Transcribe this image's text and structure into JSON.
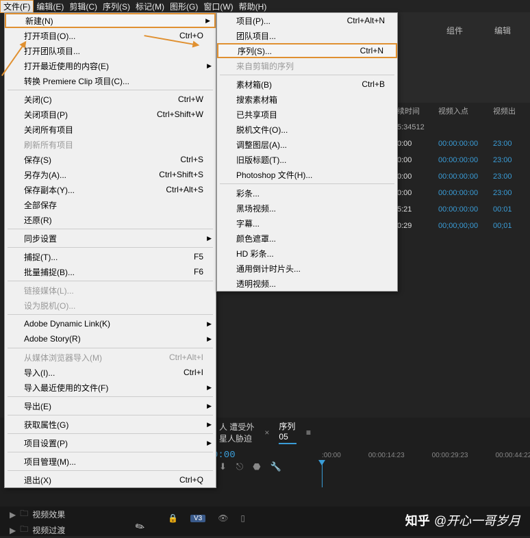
{
  "menubar": [
    {
      "label": "文件(F)",
      "active": true
    },
    {
      "label": "编辑(E)"
    },
    {
      "label": "剪辑(C)"
    },
    {
      "label": "序列(S)"
    },
    {
      "label": "标记(M)"
    },
    {
      "label": "图形(G)"
    },
    {
      "label": "窗口(W)"
    },
    {
      "label": "帮助(H)"
    }
  ],
  "file_menu": [
    {
      "label": "新建(N)",
      "arrow": true,
      "highlight": true
    },
    {
      "label": "打开项目(O)...",
      "shortcut": "Ctrl+O"
    },
    {
      "label": "打开团队项目..."
    },
    {
      "label": "打开最近使用的内容(E)",
      "arrow": true
    },
    {
      "label": "转换 Premiere Clip 项目(C)..."
    },
    {
      "sep": true
    },
    {
      "label": "关闭(C)",
      "shortcut": "Ctrl+W"
    },
    {
      "label": "关闭项目(P)",
      "shortcut": "Ctrl+Shift+W"
    },
    {
      "label": "关闭所有项目"
    },
    {
      "label": "刷新所有项目",
      "disabled": true
    },
    {
      "label": "保存(S)",
      "shortcut": "Ctrl+S"
    },
    {
      "label": "另存为(A)...",
      "shortcut": "Ctrl+Shift+S"
    },
    {
      "label": "保存副本(Y)...",
      "shortcut": "Ctrl+Alt+S"
    },
    {
      "label": "全部保存"
    },
    {
      "label": "还原(R)"
    },
    {
      "sep": true
    },
    {
      "label": "同步设置",
      "arrow": true
    },
    {
      "sep": true
    },
    {
      "label": "捕捉(T)...",
      "shortcut": "F5"
    },
    {
      "label": "批量捕捉(B)...",
      "shortcut": "F6"
    },
    {
      "sep": true
    },
    {
      "label": "链接媒体(L)...",
      "disabled": true
    },
    {
      "label": "设为脱机(O)...",
      "disabled": true
    },
    {
      "sep": true
    },
    {
      "label": "Adobe Dynamic Link(K)",
      "arrow": true
    },
    {
      "label": "Adobe Story(R)",
      "arrow": true
    },
    {
      "sep": true
    },
    {
      "label": "从媒体浏览器导入(M)",
      "shortcut": "Ctrl+Alt+I",
      "disabled": true
    },
    {
      "label": "导入(I)...",
      "shortcut": "Ctrl+I"
    },
    {
      "label": "导入最近使用的文件(F)",
      "arrow": true
    },
    {
      "sep": true
    },
    {
      "label": "导出(E)",
      "arrow": true
    },
    {
      "sep": true
    },
    {
      "label": "获取属性(G)",
      "arrow": true
    },
    {
      "sep": true
    },
    {
      "label": "项目设置(P)",
      "arrow": true
    },
    {
      "sep": true
    },
    {
      "label": "项目管理(M)..."
    },
    {
      "sep": true
    },
    {
      "label": "退出(X)",
      "shortcut": "Ctrl+Q"
    }
  ],
  "new_submenu": [
    {
      "label": "项目(P)...",
      "shortcut": "Ctrl+Alt+N"
    },
    {
      "label": "团队项目..."
    },
    {
      "label": "序列(S)...",
      "shortcut": "Ctrl+N",
      "highlight": true
    },
    {
      "label": "来自剪辑的序列",
      "disabled": true
    },
    {
      "sep": true
    },
    {
      "label": "素材箱(B)",
      "shortcut": "Ctrl+B"
    },
    {
      "label": "搜索素材箱"
    },
    {
      "label": "已共享项目"
    },
    {
      "label": "脱机文件(O)..."
    },
    {
      "label": "调整图层(A)..."
    },
    {
      "label": "旧版标题(T)..."
    },
    {
      "label": "Photoshop 文件(H)..."
    },
    {
      "sep": true
    },
    {
      "label": "彩条..."
    },
    {
      "label": "黑场视频..."
    },
    {
      "label": "字幕..."
    },
    {
      "label": "颜色遮罩..."
    },
    {
      "label": "HD 彩条..."
    },
    {
      "label": "通用倒计时片头..."
    },
    {
      "label": "透明视频..."
    }
  ],
  "bg_tabs": [
    "组件",
    "编辑"
  ],
  "table": {
    "headers": [
      "续时间",
      "视频入点",
      "视频出"
    ],
    "rows": [
      [
        "5:34512",
        "",
        ""
      ],
      [
        "0:00",
        "00:00:00:00",
        "23:00"
      ],
      [
        "0:00",
        "00:00:00:00",
        "23:00"
      ],
      [
        "0:00",
        "00:00:00:00",
        "23:00"
      ],
      [
        "0:00",
        "00:00:00:00",
        "23:00"
      ],
      [
        "5:21",
        "00:00:00:00",
        "00:01"
      ],
      [
        "0:29",
        "00;00;00;00",
        "00;01"
      ]
    ]
  },
  "lower": {
    "tab_inactive": "人 遭受外星人胁迫",
    "tab_active": "序列 05",
    "close_x": "×",
    "hamburger": "≡",
    "timecode": "0:00",
    "ruler": [
      ":00:00",
      "00:00:14:23",
      "00:00:29:23",
      "00:00:44:22"
    ],
    "v3_label": "V3"
  },
  "folders": [
    "视频效果",
    "视频过渡"
  ],
  "watermark": {
    "logo": "知乎",
    "author": "@开心一哥岁月"
  }
}
